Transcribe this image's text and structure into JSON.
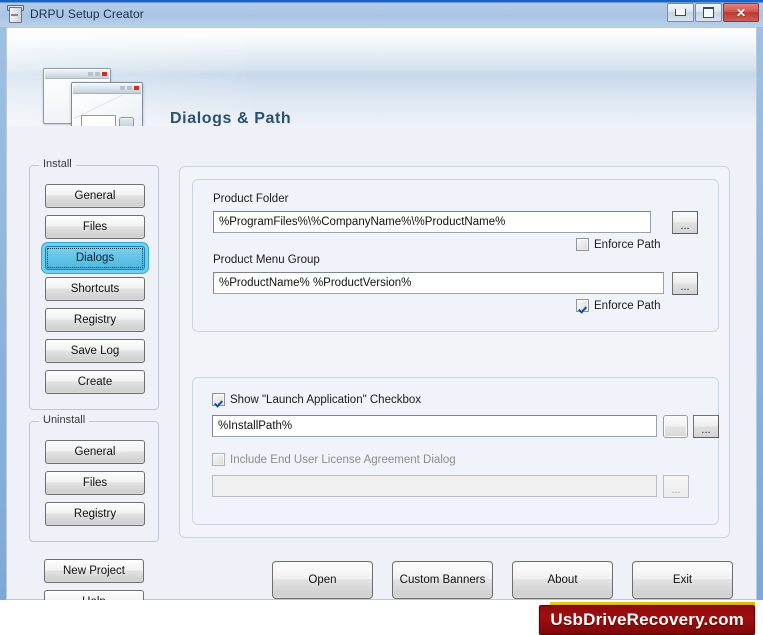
{
  "window": {
    "title": "DRPU Setup Creator",
    "icon": "app-icon",
    "controls": {
      "minimize": "minimize-icon",
      "maximize": "maximize-icon",
      "close": "✕"
    }
  },
  "header": {
    "title": "Dialogs & Path",
    "icon": "dialogs-windows-icon"
  },
  "sidebar": {
    "install": {
      "legend": "Install",
      "items": [
        {
          "label": "General",
          "selected": false
        },
        {
          "label": "Files",
          "selected": false
        },
        {
          "label": "Dialogs",
          "selected": true
        },
        {
          "label": "Shortcuts",
          "selected": false
        },
        {
          "label": "Registry",
          "selected": false
        },
        {
          "label": "Save Log",
          "selected": false
        },
        {
          "label": "Create",
          "selected": false
        }
      ]
    },
    "uninstall": {
      "legend": "Uninstall",
      "items": [
        {
          "label": "General",
          "selected": false
        },
        {
          "label": "Files",
          "selected": false
        },
        {
          "label": "Registry",
          "selected": false
        }
      ]
    },
    "extra": [
      {
        "label": "New Project"
      },
      {
        "label": "Help"
      }
    ]
  },
  "main": {
    "product_folder": {
      "label": "Product Folder",
      "value": "%ProgramFiles%\\%CompanyName%\\%ProductName%",
      "placeholder": "",
      "browse_label": "...",
      "enforce_path": {
        "label": "Enforce Path",
        "checked": false
      }
    },
    "product_menu_group": {
      "label": "Product Menu Group",
      "value": "%ProductName% %ProductVersion%",
      "placeholder": "",
      "browse_label": "...",
      "enforce_path": {
        "label": "Enforce Path",
        "checked": true
      }
    },
    "launch_application": {
      "label": "Show \"Launch Application\" Checkbox",
      "checked": true,
      "value": "%InstallPath%",
      "placeholder": "",
      "extra_button_label": "",
      "browse_label": "..."
    },
    "eula": {
      "label": "Include End User License Agreement Dialog",
      "checked": false,
      "value": "",
      "placeholder": "",
      "browse_label": "...",
      "disabled": true
    }
  },
  "actions": [
    {
      "label": "Open"
    },
    {
      "label": "Custom Banners"
    },
    {
      "label": "About"
    },
    {
      "label": "Exit"
    }
  ],
  "footer": {
    "brand": "UsbDriveRecovery.com"
  },
  "colors": {
    "accent": "#1a62c4",
    "titlebar": "#a9c4e3",
    "selection": "#62c3e6",
    "brand_red": "#8d0b0b",
    "brand_gold": "#f0c419",
    "header_title": "#2e5070",
    "body_bg": "#eef1f8"
  }
}
